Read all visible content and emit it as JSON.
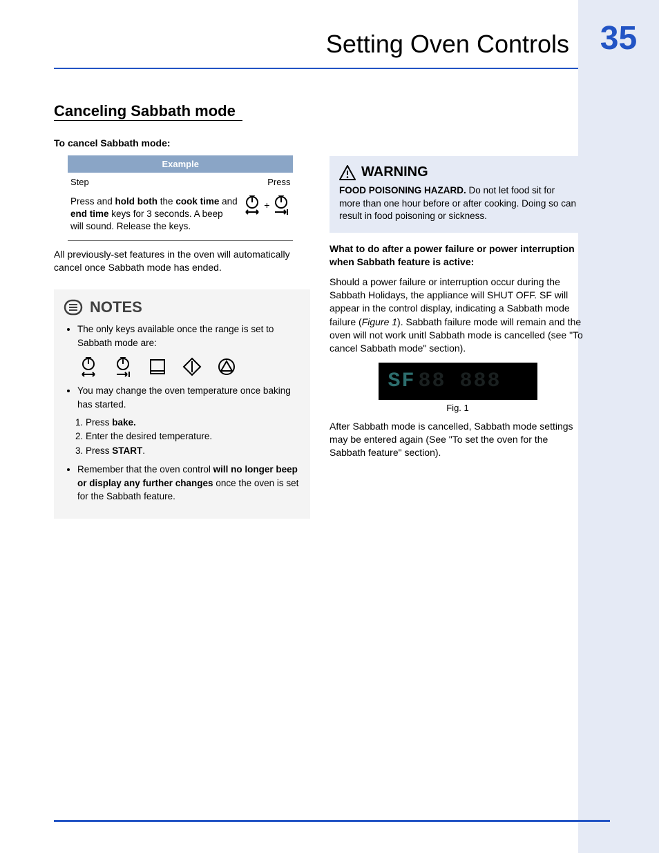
{
  "header": {
    "title": "Setting Oven Controls",
    "page_number": "35"
  },
  "left": {
    "section_title": "Canceling Sabbath mode",
    "sub_heading": "To cancel Sabbath mode:",
    "table": {
      "header": "Example",
      "col1": "Step",
      "col2": "Press",
      "row_text_a": "Press and ",
      "row_text_b": "hold both",
      "row_text_c": " the ",
      "row_text_d": "cook time",
      "row_text_e": " and ",
      "row_text_f": "end time",
      "row_text_g": " keys for 3 seconds. A beep will sound. Release the keys.",
      "plus": " + "
    },
    "after_table": "All previously-set features in the oven will automatically cancel once Sabbath mode has ended.",
    "notes": {
      "title": "NOTES",
      "b1": "The only keys available once the range is set to Sabbath mode are:",
      "b2": "You may change the oven temperature once baking has started.",
      "s1a": "Press ",
      "s1b": "bake.",
      "s2": "Enter the desired temperature.",
      "s3a": "Press ",
      "s3b": "START",
      "s3c": ".",
      "b3a": "Remember that the oven control ",
      "b3b": "will no longer beep or display any further changes",
      "b3c": " once the oven is set for the Sabbath feature."
    }
  },
  "right": {
    "warn": {
      "title": "WARNING",
      "lead": "FOOD POISONING HAZARD.",
      "body": " Do not let food sit for more than one hour before or after cooking. Doing so can result in food poisoning or sickness."
    },
    "h2": "What to do after a power failure or power interruption when Sabbath feature is active:",
    "p1a": "Should a power failure or interruption occur during the Sabbath Holidays, the appliance will SHUT OFF. SF will appear in the control display, indicating a Sabbath mode failure (",
    "p1b": "Figure 1",
    "p1c": "). Sabbath failure mode will remain and the oven will not work unitl Sabbath mode is cancelled (see \"To cancel Sabbath mode\" section).",
    "display": {
      "sf": "SF",
      "dim": "88 888"
    },
    "fig": "Fig. 1",
    "p2": "After Sabbath mode is cancelled, Sabbath mode settings may be entered again (See \"To set the oven for the Sabbath feature\" section)."
  }
}
